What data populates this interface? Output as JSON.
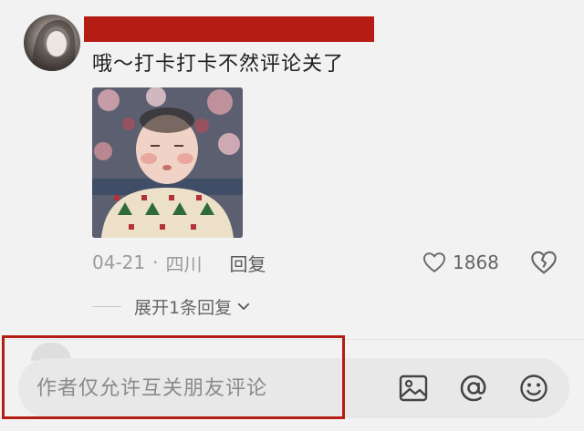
{
  "comment": {
    "text": "哦～打卡打卡不然评论关了",
    "date": "04-21",
    "separator": "·",
    "location": "四川",
    "reply_label": "回复",
    "like_count": "1868",
    "expand_label": "展开1条回复"
  },
  "input": {
    "placeholder": "作者仅允许互关朋友评论"
  },
  "icons": {
    "like": "heart-icon",
    "dislike": "broken-heart-icon",
    "expand": "chevron-down-icon",
    "image": "image-icon",
    "mention": "at-icon",
    "emoji": "emoji-icon"
  },
  "colors": {
    "redaction": "#b51d14",
    "highlight_border": "#b51d14",
    "background": "#f2f2f2"
  }
}
